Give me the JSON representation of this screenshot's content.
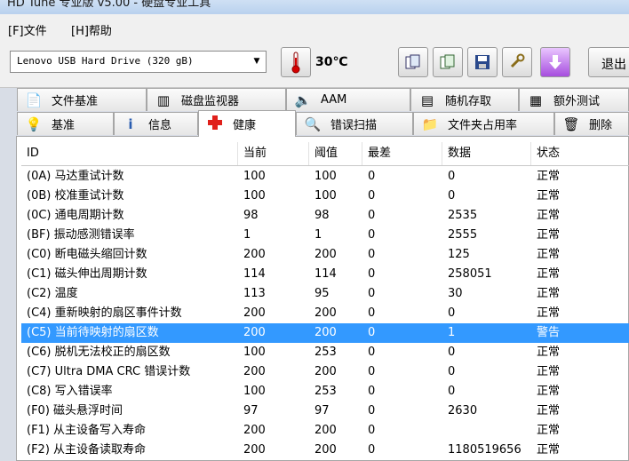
{
  "window": {
    "title": "HD Tune 专业版 v5.00 - 硬盘专业工具"
  },
  "menu": [
    {
      "label": "[F]文件"
    },
    {
      "label": "[H]帮助"
    }
  ],
  "toolbar": {
    "drive": "Lenovo  USB Hard Drive (320 gB)",
    "temperature": "30℃",
    "exit_label": "退出"
  },
  "tabs_top": [
    {
      "label": "文件基准",
      "icon": "file-benchmark-icon"
    },
    {
      "label": "磁盘监视器",
      "icon": "disk-monitor-icon"
    },
    {
      "label": "AAM",
      "icon": "speaker-icon"
    },
    {
      "label": "随机存取",
      "icon": "random-access-icon"
    },
    {
      "label": "额外测试",
      "icon": "extra-tests-icon"
    }
  ],
  "tabs_bottom": [
    {
      "label": "基准",
      "icon": "lightbulb-icon"
    },
    {
      "label": "信息",
      "icon": "info-icon"
    },
    {
      "label": "健康",
      "icon": "health-cross-icon"
    },
    {
      "label": "错误扫描",
      "icon": "magnifier-icon"
    },
    {
      "label": "文件夹占用率",
      "icon": "folder-icon"
    },
    {
      "label": "删除",
      "icon": "trash-icon"
    }
  ],
  "table": {
    "headers": [
      "ID",
      "当前",
      "阈值",
      "最差",
      "数据",
      "状态"
    ],
    "rows": [
      [
        "(0A) 马达重试计数",
        "100",
        "100",
        "0",
        "0",
        "正常"
      ],
      [
        "(0B) 校准重试计数",
        "100",
        "100",
        "0",
        "0",
        "正常"
      ],
      [
        "(0C) 通电周期计数",
        "98",
        "98",
        "0",
        "2535",
        "正常"
      ],
      [
        "(BF) 振动感测错误率",
        "1",
        "1",
        "0",
        "2555",
        "正常"
      ],
      [
        "(C0) 断电磁头缩回计数",
        "200",
        "200",
        "0",
        "125",
        "正常"
      ],
      [
        "(C1) 磁头伸出周期计数",
        "114",
        "114",
        "0",
        "258051",
        "正常"
      ],
      [
        "(C2) 温度",
        "113",
        "95",
        "0",
        "30",
        "正常"
      ],
      [
        "(C4) 重新映射的扇区事件计数",
        "200",
        "200",
        "0",
        "0",
        "正常"
      ],
      [
        "(C5) 当前待映射的扇区数",
        "200",
        "200",
        "0",
        "1",
        "警告"
      ],
      [
        "(C6) 脱机无法校正的扇区数",
        "100",
        "253",
        "0",
        "0",
        "正常"
      ],
      [
        "(C7) Ultra DMA CRC 错误计数",
        "200",
        "200",
        "0",
        "0",
        "正常"
      ],
      [
        "(C8) 写入错误率",
        "100",
        "253",
        "0",
        "0",
        "正常"
      ],
      [
        "(F0) 磁头悬浮时间",
        "97",
        "97",
        "0",
        "2630",
        "正常"
      ],
      [
        "(F1) 从主设备写入寿命",
        "200",
        "200",
        "0",
        "",
        "正常"
      ],
      [
        "(F2) 从主设备读取寿命",
        "200",
        "200",
        "0",
        "1180519656",
        "正常"
      ]
    ],
    "selected_row": 8
  }
}
